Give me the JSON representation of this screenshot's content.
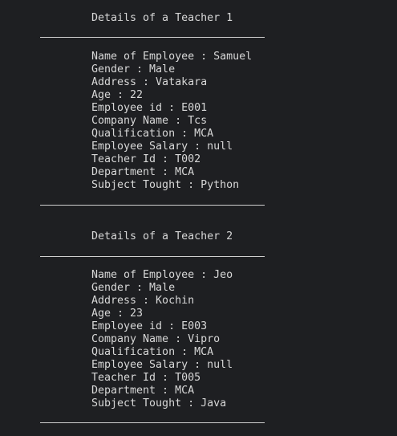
{
  "console": {
    "background": "#1e1f22",
    "text_color": "#d7d7d7",
    "teachers": [
      {
        "heading": "Details of a Teacher 1",
        "fields": [
          "Name of Employee : Samuel",
          "Gender : Male",
          "Address : Vatakara",
          "Age : 22",
          "Employee id : E001",
          "Company Name : Tcs",
          "Qualification : MCA",
          "Employee Salary : null",
          "Teacher Id : T002",
          "Department : MCA",
          "Subject Tought : Python"
        ]
      },
      {
        "heading": "Details of a Teacher 2",
        "fields": [
          "Name of Employee : Jeo",
          "Gender : Male",
          "Address : Kochin",
          "Age : 23",
          "Employee id : E003",
          "Company Name : Vipro",
          "Qualification : MCA",
          "Employee Salary : null",
          "Teacher Id : T005",
          "Department : MCA",
          "Subject Tought : Java"
        ]
      }
    ]
  }
}
